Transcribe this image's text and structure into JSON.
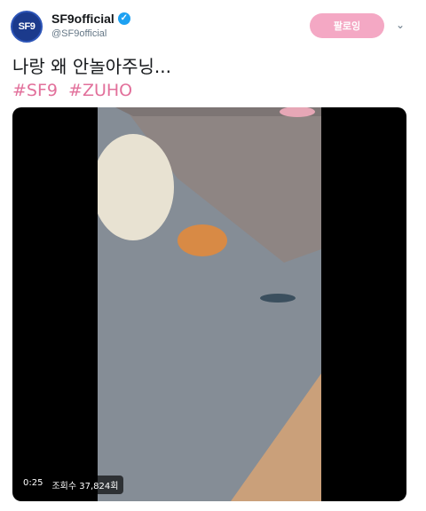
{
  "user": {
    "display_name": "SF9official",
    "handle": "@SF9official",
    "avatar_text": "SF9",
    "verified_symbol": "✓"
  },
  "follow_button": {
    "label": "팔로잉"
  },
  "menu": {
    "caret": "⌄"
  },
  "tweet": {
    "text": "나랑 왜 안놀아주닝...",
    "hashtags": [
      "#SF9",
      "#ZUHO"
    ]
  },
  "video": {
    "time": "0:25",
    "views": "조회수 37,824회"
  },
  "colors": {
    "follow_button": "#f4a8c4",
    "hashtag": "#e2709b",
    "verified": "#1da1f2",
    "avatar": "#1b3a8c"
  },
  "icons": [
    "verified-badge-icon",
    "chevron-down-icon"
  ]
}
